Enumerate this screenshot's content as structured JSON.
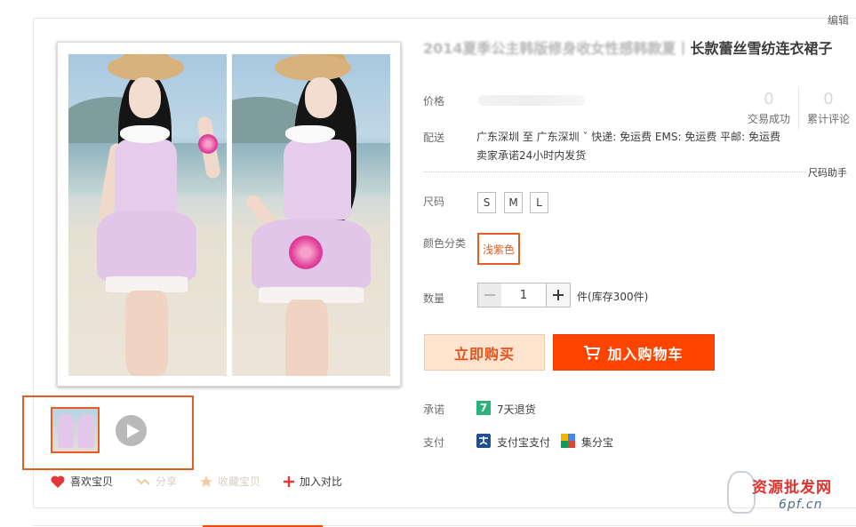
{
  "header": {
    "edit_link": "编辑"
  },
  "product": {
    "title_prefix": "2014夏季公主韩版修身收女性感韩款夏丨",
    "title_main": "长款蕾丝雪纺连衣裙子"
  },
  "labels": {
    "price": "价格",
    "delivery": "配送",
    "size": "尺码",
    "color": "颜色分类",
    "quantity": "数量",
    "promise": "承诺",
    "payment": "支付"
  },
  "stats": [
    {
      "num": "0",
      "caption": "交易成功"
    },
    {
      "num": "0",
      "caption": "累计评论"
    }
  ],
  "delivery": {
    "line1": "广东深圳  至  广东深圳 ˇ  快递: 免运费 EMS: 免运费 平邮: 免运费",
    "line2": "卖家承诺24小时内发货",
    "size_help": "尺码助手"
  },
  "sizes": [
    "S",
    "M",
    "L"
  ],
  "colors": [
    "浅紫色"
  ],
  "quantity": {
    "value": "1",
    "stock": "件(库存300件)"
  },
  "buttons": {
    "buy_now": "立即购买",
    "add_to_cart": "加入购物车"
  },
  "promise": {
    "icon_text": "7",
    "text": "7天退货"
  },
  "payment": {
    "alipay": "支付宝支付",
    "jifenbao": "集分宝"
  },
  "actions": {
    "like": "喜欢宝贝",
    "share": "分享",
    "favorite": "收藏宝贝",
    "compare": "加入对比"
  },
  "watermark": {
    "text": "资源批发网",
    "url": "6pf.cn"
  },
  "colors_theme": {
    "accent": "#ff4400",
    "accent_dark": "#e35e23",
    "buy_bg": "#ffe4d0",
    "promise_green": "#2ab27b"
  }
}
